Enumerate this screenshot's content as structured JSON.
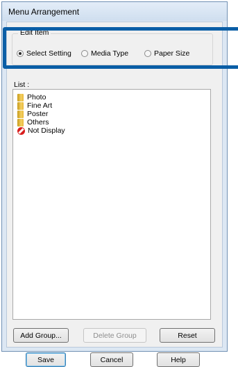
{
  "window": {
    "title": "Menu Arrangement"
  },
  "edit_item": {
    "title": "Edit Item",
    "options": [
      {
        "label": "Select Setting",
        "selected": true
      },
      {
        "label": "Media Type",
        "selected": false
      },
      {
        "label": "Paper Size",
        "selected": false
      }
    ]
  },
  "list": {
    "label": "List :",
    "items": [
      {
        "label": "Photo",
        "icon": "folder-icon"
      },
      {
        "label": "Fine Art",
        "icon": "folder-icon"
      },
      {
        "label": "Poster",
        "icon": "folder-icon"
      },
      {
        "label": "Others",
        "icon": "folder-icon"
      },
      {
        "label": "Not Display",
        "icon": "no-entry-icon"
      }
    ]
  },
  "buttons": {
    "add_group": "Add Group...",
    "delete_group": "Delete Group",
    "reset": "Reset",
    "save": "Save",
    "cancel": "Cancel",
    "help": "Help"
  },
  "colors": {
    "highlight": "#0a5ea6",
    "no_display_icon": "#d81e1e"
  }
}
